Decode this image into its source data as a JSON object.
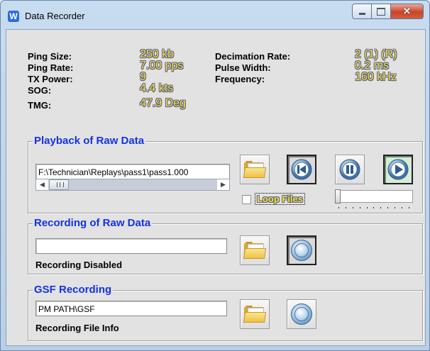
{
  "window": {
    "title": "Data Recorder",
    "app_icon_letter": "W"
  },
  "info": {
    "left": [
      {
        "label": "Ping Size:",
        "value": "250 kb"
      },
      {
        "label": "Ping Rate:",
        "value": "7.00 pps"
      },
      {
        "label": "TX Power:",
        "value": "9"
      },
      {
        "label": "SOG:",
        "value": "4.4 kts"
      },
      {
        "label": "TMG:",
        "value": "47.9 Deg"
      }
    ],
    "right": [
      {
        "label": "Decimation Rate:",
        "value": "2 (1) (R)"
      },
      {
        "label": "Pulse Width:",
        "value": "0.2 ms"
      },
      {
        "label": "Frequency:",
        "value": "160 kHz"
      }
    ]
  },
  "playback": {
    "title": "Playback of Raw Data",
    "path": "F:\\Technician\\Replays\\pass1\\pass1.000",
    "loop_label": "Loop Files",
    "loop_checked": false,
    "play_active": true,
    "progress": 0
  },
  "recording": {
    "title": "Recording of Raw Data",
    "path": "",
    "status": "Recording Disabled"
  },
  "gsf": {
    "title": "GSF Recording",
    "path": "PM PATH\\GSF",
    "status": "Recording File Info"
  },
  "colors": {
    "value_yellow": "#f2e33a",
    "group_title_blue": "#1432e6"
  }
}
